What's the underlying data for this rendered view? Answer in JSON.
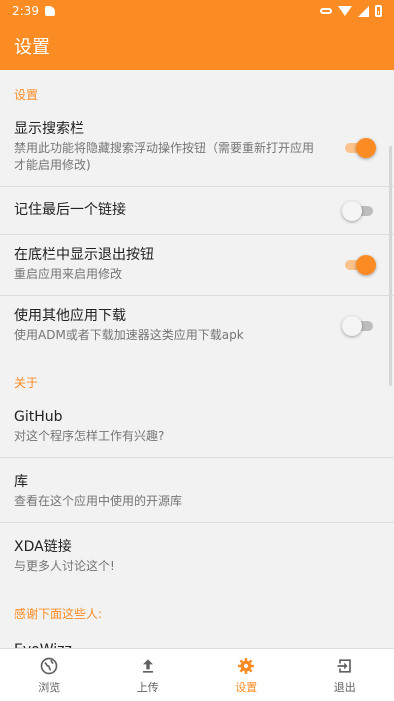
{
  "status_bar": {
    "time": "2:39"
  },
  "app_bar": {
    "title": "设置"
  },
  "sections": {
    "settings_header": "设置",
    "about_header": "关于",
    "thanks_header": "感谢下面这些人:"
  },
  "settings": [
    {
      "title": "显示搜索栏",
      "summary": "禁用此功能将隐藏搜索浮动操作按钮（需要重新打开应用才能启用修改)",
      "enabled": true
    },
    {
      "title": "记住最后一个链接",
      "summary": "",
      "enabled": false
    },
    {
      "title": "在底栏中显示退出按钮",
      "summary": "重启应用来启用修改",
      "enabled": true
    },
    {
      "title": "使用其他应用下载",
      "summary": "使用ADM或者下载加速器这类应用下载apk",
      "enabled": false
    }
  ],
  "about": [
    {
      "title": "GitHub",
      "summary": "对这个程序怎样工作有兴趣?"
    },
    {
      "title": "库",
      "summary": "查看在这个应用中使用的开源库"
    },
    {
      "title": "XDA链接",
      "summary": "与更多人讨论这个!"
    }
  ],
  "thanks": [
    {
      "title": "EvoWizz"
    }
  ],
  "bottom_nav": {
    "items": [
      {
        "label": "浏览",
        "icon": "globe-icon",
        "active": false
      },
      {
        "label": "上传",
        "icon": "upload-icon",
        "active": false
      },
      {
        "label": "设置",
        "icon": "gear-icon",
        "active": true
      },
      {
        "label": "退出",
        "icon": "exit-icon",
        "active": false
      }
    ]
  },
  "colors": {
    "accent": "#fb8c24",
    "accent_light": "#fcc28b"
  }
}
